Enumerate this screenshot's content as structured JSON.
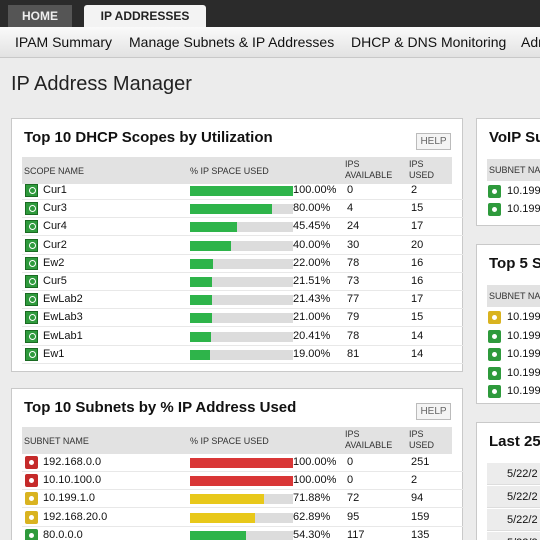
{
  "topbar": {
    "tab_home": "HOME",
    "tab_ip": "IP ADDRESSES"
  },
  "subnav": [
    "IPAM Summary",
    "Manage Subnets & IP Addresses",
    "DHCP & DNS Monitoring",
    "Adm"
  ],
  "page_title": "IP Address Manager",
  "dhcp_panel": {
    "title": "Top 10 DHCP Scopes by Utilization",
    "help": "HELP",
    "columns": [
      "SCOPE NAME",
      "% IP SPACE USED",
      "IPS\nAVAILABLE",
      "IPS\nUSED"
    ],
    "rows": [
      {
        "name": "Cur1",
        "pct": "100.00%",
        "used_fraction": 1.0,
        "available": "0",
        "used": "2",
        "status": "green"
      },
      {
        "name": "Cur3",
        "pct": "80.00%",
        "used_fraction": 0.8,
        "available": "4",
        "used": "15",
        "status": "green"
      },
      {
        "name": "Cur4",
        "pct": "45.45%",
        "used_fraction": 0.4545,
        "available": "24",
        "used": "17",
        "status": "green"
      },
      {
        "name": "Cur2",
        "pct": "40.00%",
        "used_fraction": 0.4,
        "available": "30",
        "used": "20",
        "status": "green"
      },
      {
        "name": "Ew2",
        "pct": "22.00%",
        "used_fraction": 0.22,
        "available": "78",
        "used": "16",
        "status": "green"
      },
      {
        "name": "Cur5",
        "pct": "21.51%",
        "used_fraction": 0.2151,
        "available": "73",
        "used": "16",
        "status": "green"
      },
      {
        "name": "EwLab2",
        "pct": "21.43%",
        "used_fraction": 0.2143,
        "available": "77",
        "used": "17",
        "status": "green"
      },
      {
        "name": "EwLab3",
        "pct": "21.00%",
        "used_fraction": 0.21,
        "available": "79",
        "used": "15",
        "status": "green"
      },
      {
        "name": "EwLab1",
        "pct": "20.41%",
        "used_fraction": 0.2041,
        "available": "78",
        "used": "14",
        "status": "green"
      },
      {
        "name": "Ew1",
        "pct": "19.00%",
        "used_fraction": 0.19,
        "available": "81",
        "used": "14",
        "status": "green"
      }
    ]
  },
  "subnet_panel": {
    "title": "Top 10 Subnets by % IP Address Used",
    "help": "HELP",
    "columns": [
      "SUBNET NAME",
      "% IP SPACE USED",
      "IPS\nAVAILABLE",
      "IPS\nUSED"
    ],
    "rows": [
      {
        "name": "192.168.0.0",
        "pct": "100.00%",
        "used_fraction": 1.0,
        "available": "0",
        "used": "251",
        "status": "red"
      },
      {
        "name": "10.10.100.0",
        "pct": "100.00%",
        "used_fraction": 1.0,
        "available": "0",
        "used": "2",
        "status": "red"
      },
      {
        "name": "10.199.1.0",
        "pct": "71.88%",
        "used_fraction": 0.7188,
        "available": "72",
        "used": "94",
        "status": "yellow"
      },
      {
        "name": "192.168.20.0",
        "pct": "62.89%",
        "used_fraction": 0.6289,
        "available": "95",
        "used": "159",
        "status": "yellow"
      },
      {
        "name": "80.0.0.0",
        "pct": "54.30%",
        "used_fraction": 0.543,
        "available": "117",
        "used": "135",
        "status": "green"
      }
    ]
  },
  "voip_panel": {
    "title": "VoIP Su",
    "column": "SUBNET NA",
    "rows": [
      "10.199",
      "10.199"
    ]
  },
  "top5_panel": {
    "title": "Top 5 S",
    "column": "SUBNET NA",
    "rows": [
      {
        "name": "10.199",
        "status": "yellow"
      },
      {
        "name": "10.199",
        "status": "green"
      },
      {
        "name": "10.199",
        "status": "green"
      },
      {
        "name": "10.199",
        "status": "green"
      },
      {
        "name": "10.199",
        "status": "green"
      }
    ]
  },
  "last_panel": {
    "title": "Last 25",
    "rows": [
      "5/22/2",
      "5/22/2",
      "5/22/2",
      "5/22/2"
    ]
  },
  "colors": {
    "green": "#2eb44a",
    "yellow": "#e8c81a",
    "red": "#d93636",
    "icon_green": "#2e9a3c",
    "icon_red": "#c52a2a",
    "icon_yellow": "#d9b320"
  }
}
